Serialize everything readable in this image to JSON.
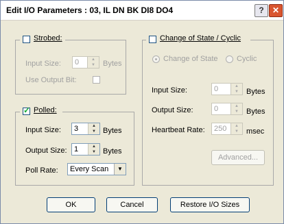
{
  "window": {
    "title": "Edit I/O Parameters : 03, IL DN BK DI8 DO4",
    "help_label": "?",
    "close_label": "✕"
  },
  "strobed": {
    "label": "Strobed:",
    "checked": false,
    "input_size_label": "Input Size:",
    "input_size_value": "0",
    "bytes_label": "Bytes",
    "use_output_bit_label": "Use Output Bit:"
  },
  "polled": {
    "label": "Polled:",
    "checked": true,
    "input_size_label": "Input Size:",
    "input_size_value": "3",
    "input_bytes_label": "Bytes",
    "output_size_label": "Output Size:",
    "output_size_value": "1",
    "output_bytes_label": "Bytes",
    "poll_rate_label": "Poll Rate:",
    "poll_rate_value": "Every Scan"
  },
  "cos": {
    "label": "Change of State / Cyclic",
    "checked": false,
    "radio_cos_label": "Change of State",
    "radio_cyclic_label": "Cyclic",
    "input_size_label": "Input Size:",
    "input_size_value": "0",
    "input_bytes_label": "Bytes",
    "output_size_label": "Output Size:",
    "output_size_value": "0",
    "output_bytes_label": "Bytes",
    "heartbeat_label": "Heartbeat Rate:",
    "heartbeat_value": "250",
    "msec_label": "msec",
    "advanced_label": "Advanced..."
  },
  "footer": {
    "ok_label": "OK",
    "cancel_label": "Cancel",
    "restore_label": "Restore I/O Sizes"
  }
}
